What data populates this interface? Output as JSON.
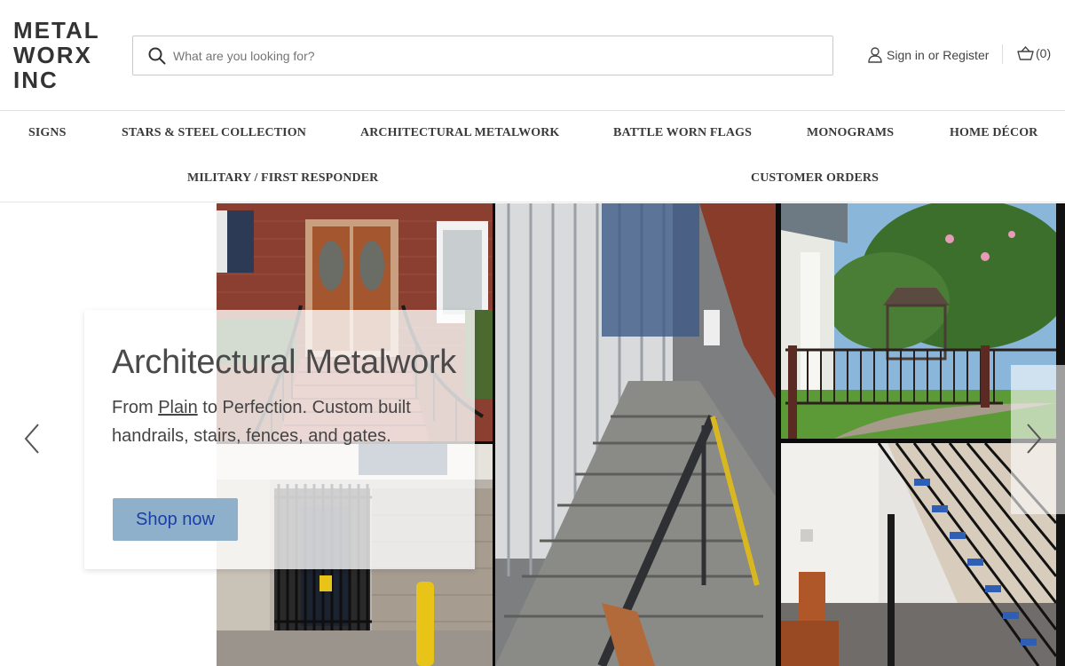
{
  "brand": {
    "logo_line1": "METAL",
    "logo_line2": "WORX",
    "logo_line3": "INC"
  },
  "search": {
    "placeholder": "What are you looking for?",
    "value": "",
    "icon": "search-icon"
  },
  "account": {
    "sign_in": "Sign in",
    "or": "or",
    "register": "Register",
    "icon": "user-icon"
  },
  "cart": {
    "count_label": "(0)",
    "icon": "basket-icon"
  },
  "nav": {
    "row1": [
      "SIGNS",
      "STARS & STEEL COLLECTION",
      "ARCHITECTURAL METALWORK",
      "BATTLE WORN FLAGS",
      "MONOGRAMS",
      "HOME DÉCOR"
    ],
    "row2": [
      "MILITARY / FIRST RESPONDER",
      "CUSTOMER ORDERS"
    ]
  },
  "hero": {
    "title": "Architectural Metalwork",
    "text_before": "From ",
    "text_link": "Plain",
    "text_after": " to Perfection. Custom built handrails, stairs, fences, and gates.",
    "button": "Shop now",
    "prev_icon": "chevron-left-icon",
    "next_icon": "chevron-right-icon"
  },
  "colors": {
    "button_bg": "#8fb0cb",
    "button_text": "#1a3fa5",
    "text": "#333333"
  }
}
